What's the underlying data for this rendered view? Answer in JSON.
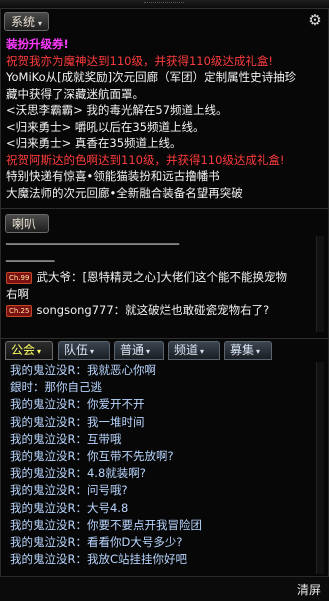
{
  "system_tab": {
    "label": "系统",
    "arrow": "▾"
  },
  "settings_icon": "gear-icon",
  "system_messages": [
    {
      "text": "装扮升级券!",
      "color": "pink"
    },
    {
      "text": "祝贺我亦为魔神达到110级，并获得110级达成礼盒!",
      "color": "red"
    },
    {
      "text": "YoMiKo从[成就奖励]次元回廊（军团）定制属性史诗抽珍",
      "color": "white"
    },
    {
      "text": "藏中获得了深藏迷航面罩。",
      "color": "white"
    },
    {
      "text": "<沃思李霸霸> 我的毒光解在57频道上线。",
      "color": "white"
    },
    {
      "text": "<归来勇士> 嚼吼以后在35频道上线。",
      "color": "white"
    },
    {
      "text": "<归来勇士>     真香在35频道上线。",
      "color": "white"
    },
    {
      "text": "祝贺阿斯达的色啊达到110级，并获得110级达成礼盒!",
      "color": "red"
    },
    {
      "text": "特别快递有惊喜•领能猫装扮和远古撸幡书",
      "color": "white"
    },
    {
      "text": "大魔法师的次元回廊•全新融合装备名望再突破",
      "color": "white"
    }
  ],
  "chat_tab": {
    "label": "喇叭"
  },
  "chat_messages": [
    {
      "badge": "",
      "text": "    ─────────────────────────"
    },
    {
      "badge": "",
      "text": "  ───────"
    },
    {
      "badge": "Ch.99",
      "text": "武大爷：[恩特精灵之心]大佬们这个能不能换宠物"
    },
    {
      "badge": "",
      "text": "          右啊"
    },
    {
      "badge": "Ch.25",
      "text": "songsong777：就这破烂也敢碰瓷宠物右了?"
    }
  ],
  "team_tabs": [
    {
      "label": "公会",
      "arrow": "▾",
      "active": true
    },
    {
      "label": "队伍",
      "arrow": "▾",
      "active": false
    },
    {
      "label": "普通",
      "arrow": "▾",
      "active": false
    },
    {
      "label": "频道",
      "arrow": "▾",
      "active": false
    },
    {
      "label": "募集",
      "arrow": "▾",
      "active": false
    }
  ],
  "team_messages": [
    "我的鬼泣没R：我就恶心你啊",
    "銀时：那你自己逃",
    "我的鬼泣没R：你爱开不开",
    "我的鬼泣没R：我一堆时间",
    "我的鬼泣没R：互带哦",
    "我的鬼泣没R：你互带不先放啊?",
    "我的鬼泣没R：4.8就装啊?",
    "我的鬼泣没R：问号哦?",
    "我的鬼泣没R：大号4.8",
    "我的鬼泣没R：你要不要点开我冒险团",
    "我的鬼泣没R：看看你D大号多少?",
    "我的鬼泣没R：我放C站挂挂你好吧"
  ],
  "clear_label": "清屏"
}
